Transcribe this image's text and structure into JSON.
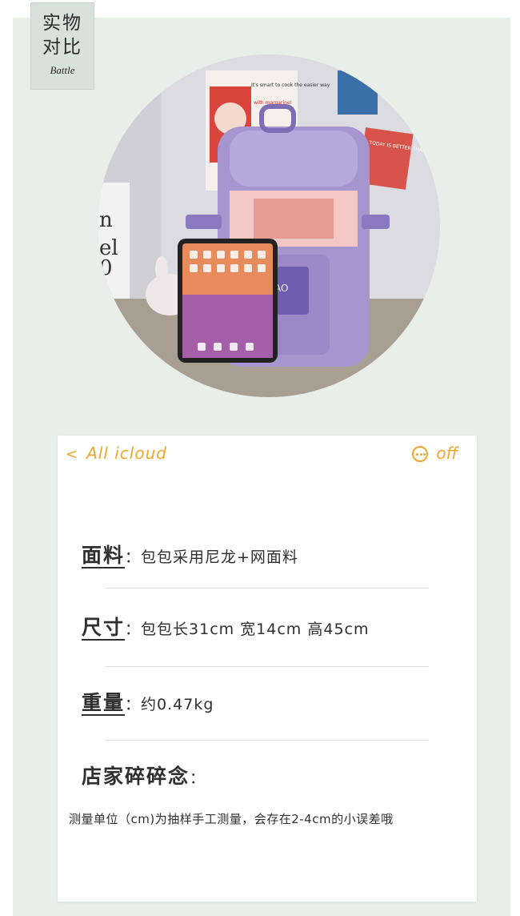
{
  "badge": {
    "zh_line1": "实物",
    "zh_line2": "对比",
    "en": "Battle"
  },
  "photo": {
    "poster_text": "It's smart to cook the easier way",
    "poster_sub": "with margarine!",
    "sign_text": "TODAY IS BETTER THAN YESTERDAY",
    "brand_patch": "INIAO"
  },
  "notes": {
    "back_label": "All icloud",
    "more_label": "off",
    "rows": [
      {
        "label": "面料",
        "value": "：包包采用尼龙+网面料"
      },
      {
        "label": "尺寸",
        "value": "：包包长31cm 宽14cm 高45cm"
      },
      {
        "label": "重量",
        "value": "：约0.47kg"
      },
      {
        "label": "店家碎碎念",
        "value": "："
      }
    ],
    "footnote": "测量单位（cm)为抽样手工测量，会存在2-4cm的小误差哦"
  },
  "colors": {
    "accent": "#f1a52a",
    "panel": "#e8efe9",
    "bag": "#a596cf"
  }
}
